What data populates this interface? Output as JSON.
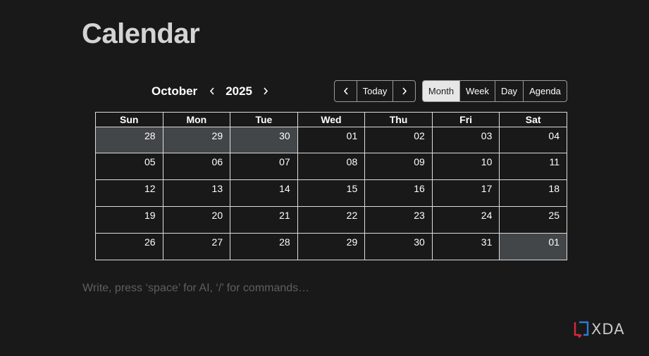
{
  "page": {
    "title": "Calendar"
  },
  "toolbar": {
    "month": "October",
    "year": "2025",
    "prev_icon": "chevron-left-icon",
    "next_icon": "chevron-right-icon",
    "today_label": "Today",
    "views": [
      "Month",
      "Week",
      "Day",
      "Agenda"
    ],
    "active_view": "Month"
  },
  "calendar": {
    "weekdays": [
      "Sun",
      "Mon",
      "Tue",
      "Wed",
      "Thu",
      "Fri",
      "Sat"
    ],
    "weeks": [
      [
        "28",
        "29",
        "30",
        "01",
        "02",
        "03",
        "04"
      ],
      [
        "05",
        "06",
        "07",
        "08",
        "09",
        "10",
        "11"
      ],
      [
        "12",
        "13",
        "14",
        "15",
        "16",
        "17",
        "18"
      ],
      [
        "19",
        "20",
        "21",
        "22",
        "23",
        "24",
        "25"
      ],
      [
        "26",
        "27",
        "28",
        "29",
        "30",
        "31",
        "01"
      ]
    ],
    "off_range_color": "#424648"
  },
  "editor": {
    "placeholder": "Write, press ‘space’ for AI, ‘/’ for commands…"
  },
  "watermark": {
    "text": "XDA"
  },
  "colors": {
    "background": "#191919",
    "border": "#dddddd",
    "active_button": "#e6e6e6",
    "watermark_red": "#d6293c",
    "watermark_blue": "#2f7ad6"
  }
}
